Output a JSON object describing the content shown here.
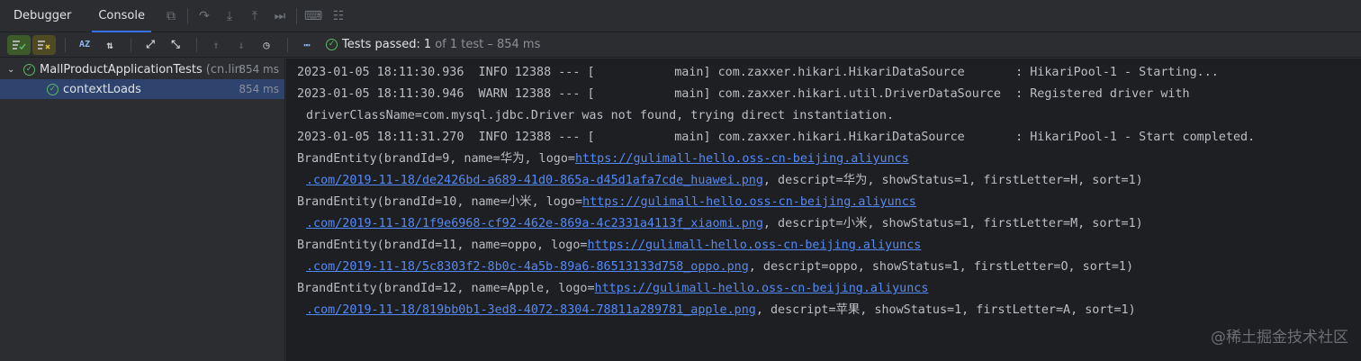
{
  "tabs": [
    {
      "label": "Debugger"
    },
    {
      "label": "Console"
    }
  ],
  "toolbar": {
    "sort_alpha_label": "AZ",
    "status": {
      "passed_label": "Tests passed:",
      "passed_count": "1",
      "rest": "of 1 test – 854 ms"
    }
  },
  "tree": {
    "root": {
      "name": "MallProductApplicationTests",
      "package": "(cn.lin",
      "time": "854 ms"
    },
    "child": {
      "name": "contextLoads",
      "time": "854 ms"
    }
  },
  "console": {
    "log1": "2023-01-05 18:11:30.936  INFO 12388 --- [           main] com.zaxxer.hikari.HikariDataSource       : HikariPool-1 - Starting...",
    "log2a": "2023-01-05 18:11:30.946  WARN 12388 --- [           main] com.zaxxer.hikari.util.DriverDataSource  : Registered driver with",
    "log2b": "driverClassName=com.mysql.jdbc.Driver was not found, trying direct instantiation.",
    "log3": "2023-01-05 18:11:31.270  INFO 12388 --- [           main] com.zaxxer.hikari.HikariDataSource       : HikariPool-1 - Start completed.",
    "brands": [
      {
        "prefix": "BrandEntity(brandId=9, name=华为, logo=",
        "link1": "https://gulimall-hello.oss-cn-beijing.aliyuncs",
        "link2": ".com/2019-11-18/de2426bd-a689-41d0-865a-d45d1afa7cde_huawei.png",
        "suffix": ", descript=华为, showStatus=1, firstLetter=H, sort=1)"
      },
      {
        "prefix": "BrandEntity(brandId=10, name=小米, logo=",
        "link1": "https://gulimall-hello.oss-cn-beijing.aliyuncs",
        "link2": ".com/2019-11-18/1f9e6968-cf92-462e-869a-4c2331a4113f_xiaomi.png",
        "suffix": ", descript=小米, showStatus=1, firstLetter=M, sort=1)"
      },
      {
        "prefix": "BrandEntity(brandId=11, name=oppo, logo=",
        "link1": "https://gulimall-hello.oss-cn-beijing.aliyuncs",
        "link2": ".com/2019-11-18/5c8303f2-8b0c-4a5b-89a6-86513133d758_oppo.png",
        "suffix": ", descript=oppo, showStatus=1, firstLetter=O, sort=1)"
      },
      {
        "prefix": "BrandEntity(brandId=12, name=Apple, logo=",
        "link1": "https://gulimall-hello.oss-cn-beijing.aliyuncs",
        "link2": ".com/2019-11-18/819bb0b1-3ed8-4072-8304-78811a289781_apple.png",
        "suffix": ", descript=苹果, showStatus=1, firstLetter=A, sort=1)"
      }
    ]
  },
  "watermark": "@稀土掘金技术社区",
  "colors": {
    "accent": "#3574f0",
    "pass": "#5fb865",
    "link": "#548af7",
    "selected": "#2e436e"
  }
}
